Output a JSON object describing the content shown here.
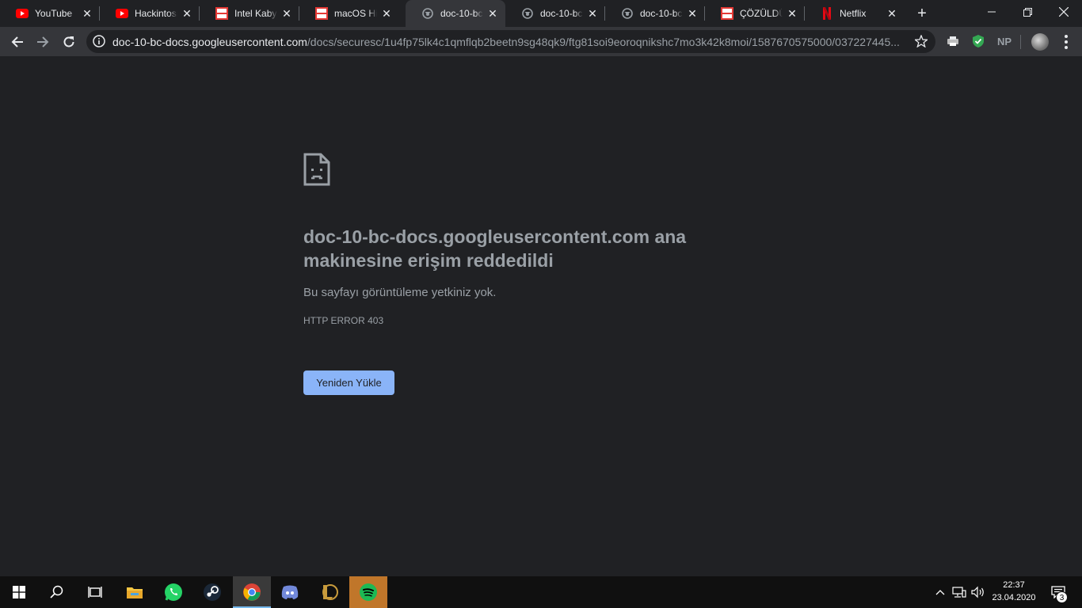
{
  "tabs": [
    {
      "title": "YouTube",
      "icon": "youtube-icon",
      "active": false
    },
    {
      "title": "Hackintosh",
      "icon": "youtube-icon",
      "active": false
    },
    {
      "title": "Intel Kaby L",
      "icon": "dsx-info-icon",
      "active": false
    },
    {
      "title": "macOS High",
      "icon": "dsx-info-icon",
      "active": false
    },
    {
      "title": "doc-10-bc-",
      "icon": "globe-icon",
      "active": true
    },
    {
      "title": "doc-10-bc-",
      "icon": "globe-icon",
      "active": false
    },
    {
      "title": "doc-10-bc-",
      "icon": "globe-icon",
      "active": false
    },
    {
      "title": "ÇÖZÜLDÜ -",
      "icon": "dsx-info-icon",
      "active": false
    },
    {
      "title": "Netflix",
      "icon": "netflix-icon",
      "active": false
    }
  ],
  "omnibox": {
    "host": "doc-10-bc-docs.googleusercontent.com",
    "path": "/docs/securesc/1u4fp75lk4c1qmflqb2beetn9sg48qk9/ftg81soi9eoroqnikshc7mo3k42k8moi/1587670575000/037227445..."
  },
  "extensions": {
    "np_label": "NP"
  },
  "error": {
    "title": "doc-10-bc-docs.googleusercontent.com ana makinesine erişim reddedildi",
    "subtitle": "Bu sayfayı görüntüleme yetkiniz yok.",
    "code": "HTTP ERROR 403",
    "reload_label": "Yeniden Yükle"
  },
  "taskbar": {
    "time": "22:37",
    "date": "23.04.2020",
    "notification_count": "3"
  },
  "colors": {
    "background": "#202124",
    "toolbar": "#35363a",
    "button": "#8ab4f8",
    "text_muted": "#9aa0a6"
  }
}
